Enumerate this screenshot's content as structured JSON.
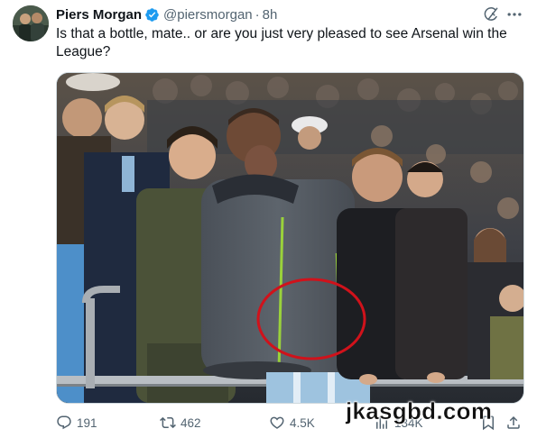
{
  "author": {
    "name": "Piers Morgan",
    "handle": "@piersmorgan",
    "separator": "·",
    "time": "8h",
    "verified": true,
    "verified_color": "#1d9bf0"
  },
  "tweet": {
    "text": "Is that a bottle, mate.. or are you just very pleased to see Arsenal win the League?"
  },
  "media": {
    "annotation_color": "#d0121b"
  },
  "actions": {
    "reply_count": "191",
    "retweet_count": "462",
    "like_count": "4.5K",
    "views_count": "134K"
  },
  "icons": {
    "grok": "grok-icon",
    "more": "more-icon",
    "reply": "reply-icon",
    "retweet": "retweet-icon",
    "like": "heart-icon",
    "views": "views-icon",
    "bookmark": "bookmark-icon",
    "share": "share-icon"
  },
  "watermark": "jkasgbd.com"
}
